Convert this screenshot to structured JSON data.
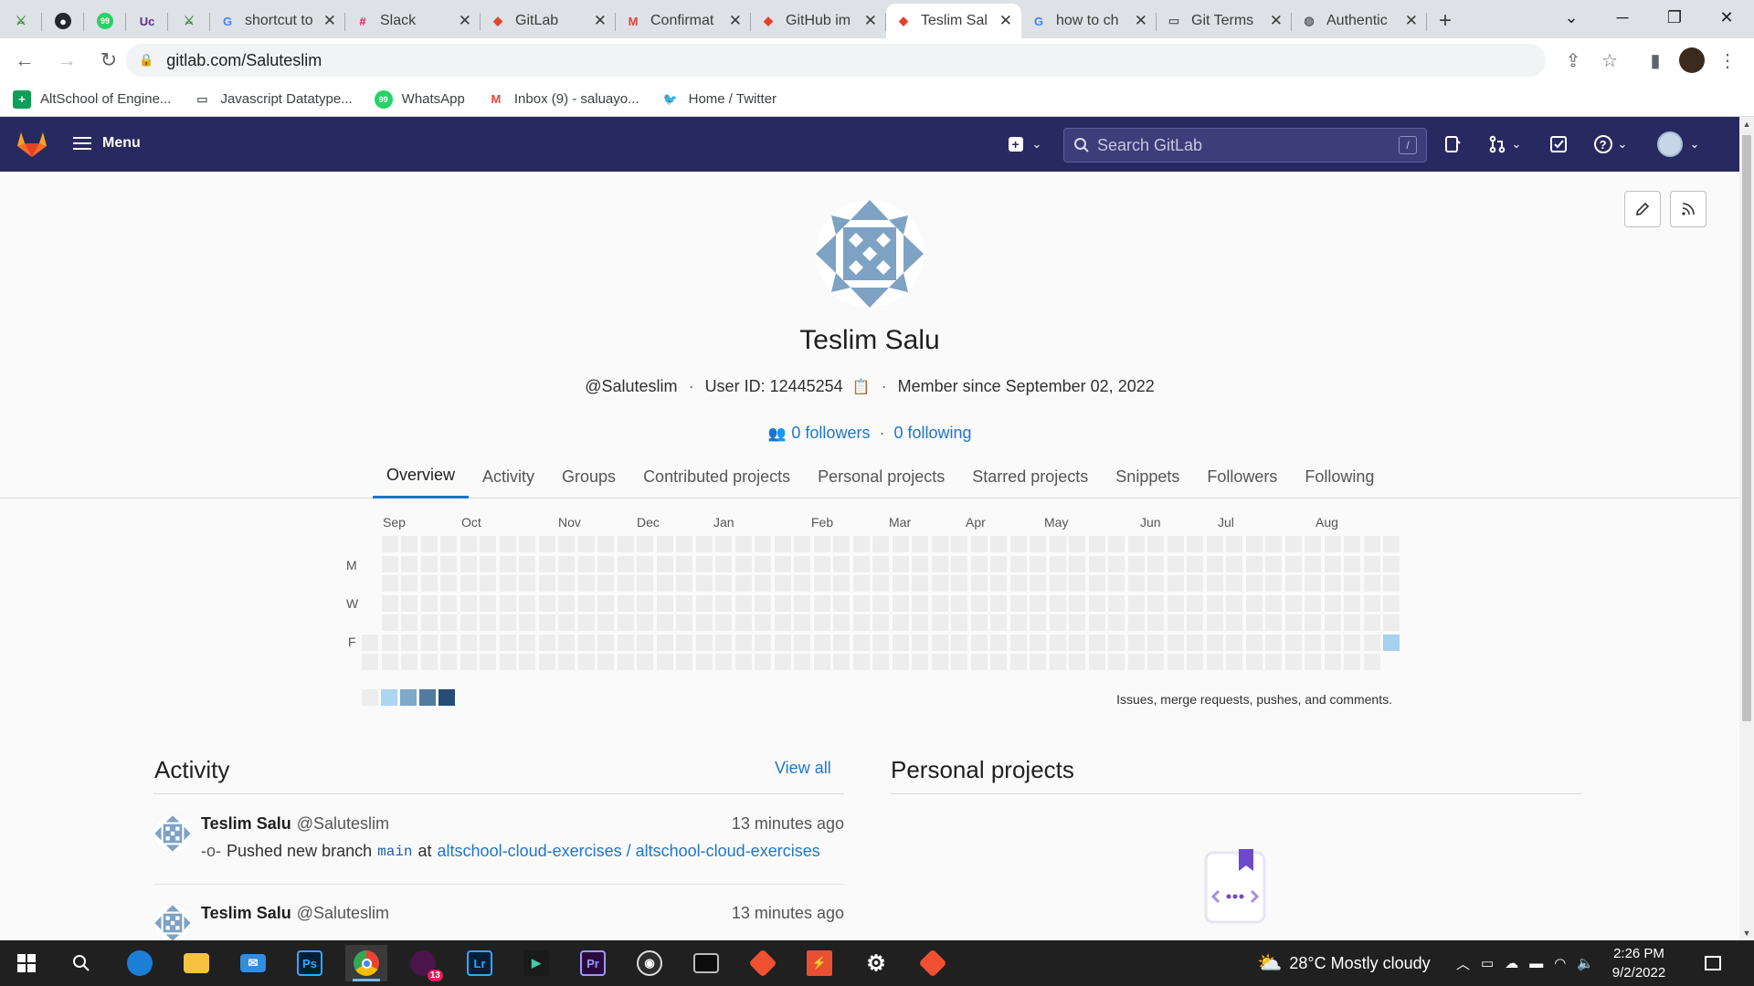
{
  "browser": {
    "tabs": [
      {
        "label": "",
        "icon": "altschool-icon",
        "pinned": true
      },
      {
        "label": "",
        "icon": "github-icon",
        "pinned": true
      },
      {
        "label": "",
        "icon": "whatsapp-icon",
        "pinned": true
      },
      {
        "label": "",
        "icon": "uc-icon",
        "pinned": true
      },
      {
        "label": "",
        "icon": "altschool-icon",
        "pinned": true
      },
      {
        "label": "shortcut to",
        "icon": "google-icon"
      },
      {
        "label": "Slack",
        "icon": "slack-icon"
      },
      {
        "label": "GitLab",
        "icon": "gitlab-icon"
      },
      {
        "label": "Confirmat",
        "icon": "gmail-icon"
      },
      {
        "label": "GitHub im",
        "icon": "gitlab-icon"
      },
      {
        "label": "Teslim Sal",
        "icon": "gitlab-icon",
        "active": true
      },
      {
        "label": "how to ch",
        "icon": "google-icon"
      },
      {
        "label": "Git Terms",
        "icon": "page-icon"
      },
      {
        "label": "Authentic",
        "icon": "globe-icon"
      }
    ],
    "url": "gitlab.com/Saluteslim",
    "bookmarks": [
      {
        "label": "AltSchool of Engine...",
        "icon": "altschool-bookmark-icon",
        "color": "#0f9d58"
      },
      {
        "label": "Javascript Datatype...",
        "icon": "folder-bookmark-icon",
        "color": "#5f6368"
      },
      {
        "label": "WhatsApp",
        "icon": "whatsapp-icon",
        "color": "#25d366"
      },
      {
        "label": "Inbox (9) - saluayo...",
        "icon": "gmail-icon",
        "color": "#ea4335"
      },
      {
        "label": "Home / Twitter",
        "icon": "twitter-icon",
        "color": "#1d9bf0"
      }
    ]
  },
  "gitlab": {
    "menu_label": "Menu",
    "search_placeholder": "Search GitLab",
    "search_shortcut": "/",
    "brand_color": "#292961"
  },
  "profile": {
    "name": "Teslim Salu",
    "username": "@Saluteslim",
    "user_id": "User ID: 12445254",
    "member_since": "Member since September 02, 2022",
    "followers": "0 followers",
    "following": "0 following",
    "tabs": [
      "Overview",
      "Activity",
      "Groups",
      "Contributed projects",
      "Personal projects",
      "Starred projects",
      "Snippets",
      "Followers",
      "Following"
    ],
    "active_tab": "Overview"
  },
  "calendar": {
    "months": [
      "Sep",
      "Oct",
      "Nov",
      "Dec",
      "Jan",
      "Feb",
      "Mar",
      "Apr",
      "May",
      "Jun",
      "Jul",
      "Aug"
    ],
    "day_labels": [
      "M",
      "W",
      "F"
    ],
    "legend_colors": [
      "#ededed",
      "#acd5f2",
      "#7fa8c9",
      "#527ba0",
      "#254e77"
    ],
    "note": "Issues, merge requests, pushes, and comments.",
    "contribution_day": "Fri"
  },
  "activity": {
    "title": "Activity",
    "view_all": "View all",
    "events": [
      {
        "name": "Teslim Salu",
        "handle": "@Saluteslim",
        "time": "13 minutes ago",
        "action": "Pushed new branch",
        "branch": "main",
        "at": "at",
        "project": "altschool-cloud-exercises / altschool-cloud-exercises"
      },
      {
        "name": "Teslim Salu",
        "handle": "@Saluteslim",
        "time": "13 minutes ago"
      }
    ]
  },
  "projects": {
    "title": "Personal projects"
  },
  "taskbar": {
    "weather": "28°C  Mostly cloudy",
    "time": "2:26 PM",
    "date": "9/2/2022",
    "badge": "13"
  }
}
